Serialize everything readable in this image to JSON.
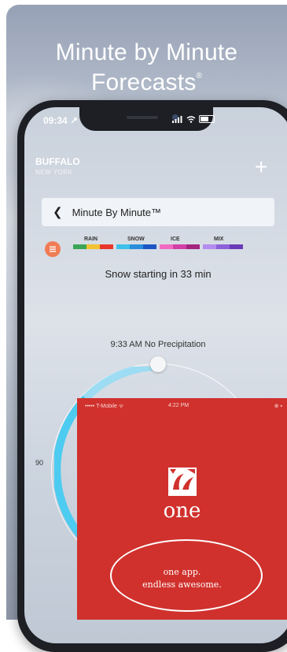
{
  "promo": {
    "headline_line1": "Minute by Minute",
    "headline_line2": "Forecasts",
    "headline_mark": "®"
  },
  "status_bar": {
    "time": "09:34",
    "location_arrow": "↗",
    "signal_icon": "signal-bars-icon",
    "wifi_icon": "wifi-icon",
    "battery_icon": "battery-icon"
  },
  "location": {
    "city": "BUFFALO",
    "state": "NEW YORK",
    "add_label": "+"
  },
  "card": {
    "back_icon": "chevron-left-icon",
    "back_glyph": "❮",
    "title": "Minute By Minute™"
  },
  "legend": {
    "items": [
      {
        "label": "RAIN",
        "colors": [
          "#3aa655",
          "#f2c230",
          "#e8352b"
        ]
      },
      {
        "label": "SNOW",
        "colors": [
          "#3ec0ea",
          "#2a8ddc",
          "#1c56c4"
        ]
      },
      {
        "label": "ICE",
        "colors": [
          "#f06ac2",
          "#d23fa6",
          "#a4247e"
        ]
      },
      {
        "label": "MIX",
        "colors": [
          "#b48cf0",
          "#8d5fd8",
          "#6a3bb8"
        ]
      }
    ]
  },
  "forecast": {
    "message": "Snow starting in 33 min",
    "precip_label": "9:33 AM No Precipitation",
    "dial_min_label": "90"
  },
  "ad": {
    "carrier": "••••• T-Mobile ᯤ",
    "time": "4:22 PM",
    "status_right": "⊕ ▪",
    "brand": "one",
    "tagline_line1": "one app.",
    "tagline_line2": "endless awesome.",
    "background_color": "#d0312d"
  }
}
